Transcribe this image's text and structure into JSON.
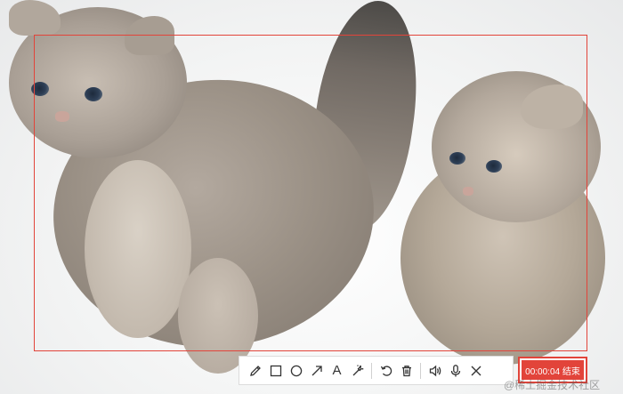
{
  "screen": {
    "photo_subject": "two kittens"
  },
  "toolbar": {
    "tools": [
      {
        "name": "pencil-icon"
      },
      {
        "name": "rectangle-icon"
      },
      {
        "name": "ellipse-icon"
      },
      {
        "name": "arrow-icon"
      },
      {
        "name": "text-tool",
        "label": "A"
      },
      {
        "name": "magic-wand-icon"
      },
      {
        "name": "undo-icon"
      },
      {
        "name": "trash-icon"
      },
      {
        "name": "speaker-icon"
      },
      {
        "name": "microphone-icon"
      },
      {
        "name": "close-icon"
      }
    ],
    "text_tool_label": "A"
  },
  "recording": {
    "timer": "00:00:04",
    "stop_label": "结束",
    "timer_and_stop": "00:00:04 结束"
  },
  "watermark": {
    "text": "@稀土掘金技术社区"
  },
  "colors": {
    "accent": "#e2443a",
    "toolbar_bg": "#ffffff"
  }
}
